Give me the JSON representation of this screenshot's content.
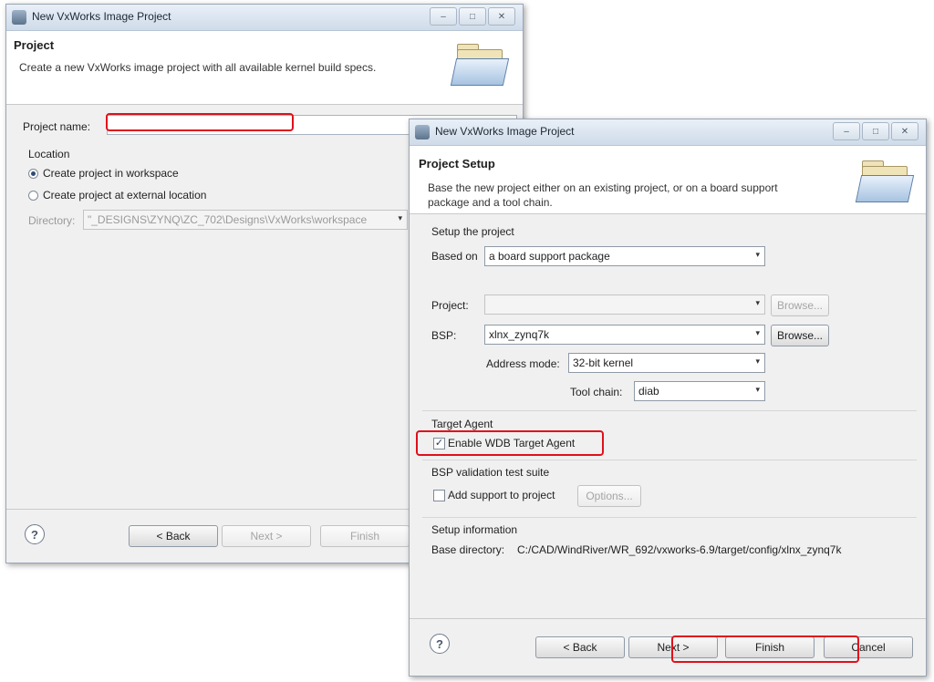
{
  "back_dialog": {
    "window_title": "New VxWorks Image Project",
    "header_title": "Project",
    "header_desc": "Create a new VxWorks image project with all available kernel build specs.",
    "project_name_label": "Project name:",
    "project_name_value": "",
    "location_label": "Location",
    "radio_workspace": "Create project in workspace",
    "radio_external": "Create project at external location",
    "directory_label": "Directory:",
    "directory_value": "\"_DESIGNS\\ZYNQ\\ZC_702\\Designs\\VxWorks\\workspace",
    "back_button": "< Back",
    "next_button": "Next >",
    "finish_button": "Finish"
  },
  "front_dialog": {
    "window_title": "New VxWorks Image Project",
    "header_title": "Project Setup",
    "header_desc_line1": "Base the new project either on an existing project, or on a board support",
    "header_desc_line2": "package and a tool chain.",
    "setup_group": "Setup the project",
    "based_on_label": "Based on",
    "based_on_value": "a board support package",
    "project_label": "Project:",
    "project_value": "",
    "browse_label": "Browse...",
    "bsp_label": "BSP:",
    "bsp_value": "xlnx_zynq7k",
    "address_mode_label": "Address mode:",
    "address_mode_value": "32-bit kernel",
    "tool_chain_label": "Tool chain:",
    "tool_chain_value": "diab",
    "target_agent_group": "Target Agent",
    "enable_wdb_label": "Enable WDB Target Agent",
    "bsp_validation_group": "BSP validation test suite",
    "add_support_label": "Add support to project",
    "options_button": "Options...",
    "setup_info_group": "Setup information",
    "base_dir_label": "Base directory:",
    "base_dir_value": "C:/CAD/WindRiver/WR_692/vxworks-6.9/target/config/xlnx_zynq7k",
    "back_button": "< Back",
    "next_button": "Next >",
    "finish_button": "Finish",
    "cancel_button": "Cancel"
  },
  "window_controls": {
    "minimize": "–",
    "maximize": "□",
    "close": "✕"
  },
  "help_glyph": "?",
  "check_glyph": "✓",
  "combo_glyph": "▾",
  "highlight_color": "#e0101b"
}
